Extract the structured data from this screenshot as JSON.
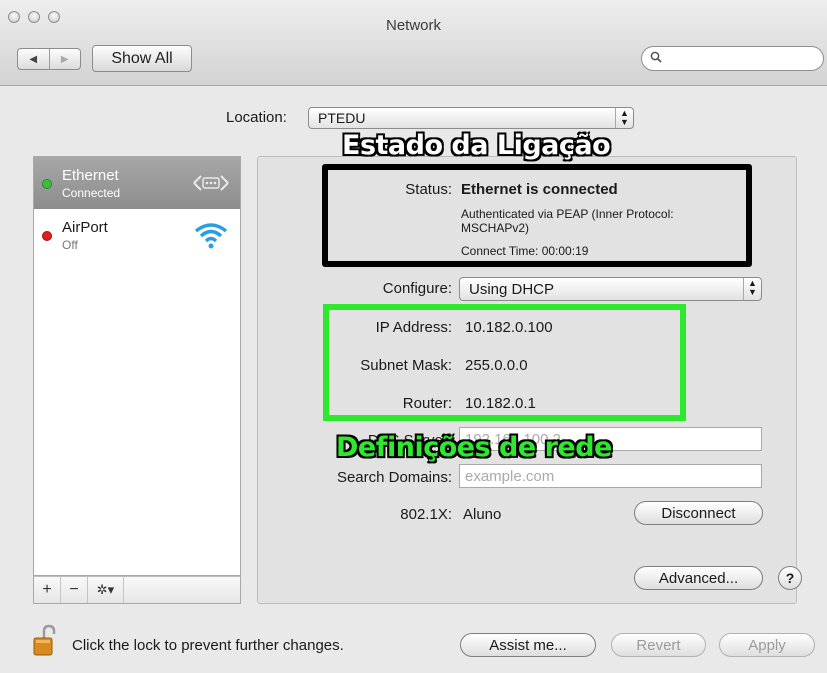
{
  "window": {
    "title": "Network"
  },
  "toolbar": {
    "back_icon": "◀",
    "forward_icon": "▶",
    "show_all_label": "Show All",
    "search_value": ""
  },
  "location": {
    "label": "Location:",
    "value": "PTEDU"
  },
  "services": [
    {
      "name": "Ethernet",
      "status": "Connected",
      "status_color": "#3bbf3b"
    },
    {
      "name": "AirPort",
      "status": "Off",
      "status_color": "#e02020"
    }
  ],
  "sidebar_controls": {
    "add": "+",
    "remove": "−",
    "action": "✲▾"
  },
  "status": {
    "label": "Status:",
    "value": "Ethernet is connected",
    "detail_1": "Authenticated via PEAP (Inner Protocol:",
    "detail_2": "MSCHAPv2)",
    "detail_3": "Connect Time: 00:00:19"
  },
  "configure": {
    "label": "Configure:",
    "value": "Using DHCP"
  },
  "ip": {
    "label": "IP Address:",
    "value": "10.182.0.100"
  },
  "subnet": {
    "label": "Subnet Mask:",
    "value": "255.0.0.0"
  },
  "router": {
    "label": "Router:",
    "value": "10.182.0.1"
  },
  "dns": {
    "label": "DNS Server:",
    "value": "192.168.100.2"
  },
  "search_domains": {
    "label": "Search Domains:",
    "placeholder": "example.com"
  },
  "dot1x": {
    "label": "802.1X:",
    "value": "Aluno",
    "disconnect_label": "Disconnect"
  },
  "advanced_label": "Advanced...",
  "help_label": "?",
  "annotations": {
    "status_box": "Estado da Ligação",
    "network_box": "Definições de rede"
  },
  "colors": {
    "black_box": "#000000",
    "green_box": "#2ee82e"
  },
  "footer": {
    "lock_text": "Click the lock to prevent further changes.",
    "assist_label": "Assist me...",
    "revert_label": "Revert",
    "apply_label": "Apply"
  }
}
